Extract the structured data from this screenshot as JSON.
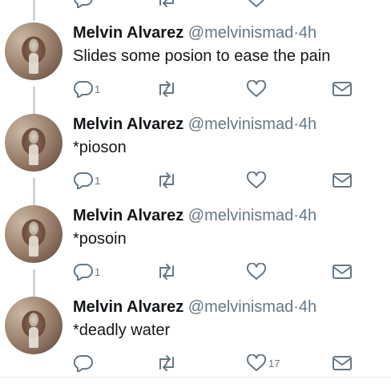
{
  "tweets": [
    {
      "name": "Melvin Alvarez",
      "handle": "@melvinismad",
      "dot": "·",
      "time": "4h",
      "text": "Slides some posion to ease the pain",
      "reply_count": "1",
      "like_count": ""
    },
    {
      "name": "Melvin Alvarez",
      "handle": "@melvinismad",
      "dot": "·",
      "time": "4h",
      "text": "*pioson",
      "reply_count": "1",
      "like_count": ""
    },
    {
      "name": "Melvin Alvarez",
      "handle": "@melvinismad",
      "dot": "·",
      "time": "4h",
      "text": "*posoin",
      "reply_count": "1",
      "like_count": ""
    },
    {
      "name": "Melvin Alvarez",
      "handle": "@melvinismad",
      "dot": "·",
      "time": "4h",
      "text": "*deadly water",
      "reply_count": "",
      "like_count": "17"
    }
  ],
  "colors": {
    "text": "#14171a",
    "muted": "#657786",
    "thread_line": "#cdd3d8"
  },
  "icons": [
    "reply-icon",
    "retweet-icon",
    "like-icon",
    "direct-message-icon"
  ]
}
